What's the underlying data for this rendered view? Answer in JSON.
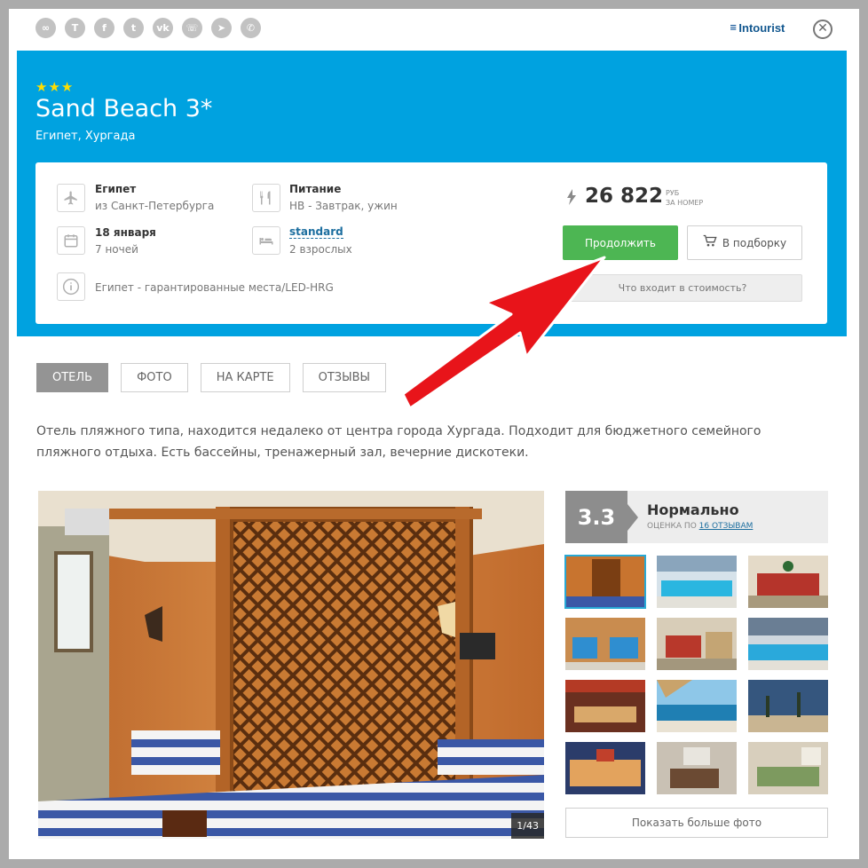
{
  "share": {
    "buttons": [
      {
        "icon": "link-icon",
        "glyph": "∞"
      },
      {
        "icon": "t-icon",
        "glyph": "T"
      },
      {
        "icon": "facebook-icon",
        "glyph": "f"
      },
      {
        "icon": "twitter-icon",
        "glyph": "t"
      },
      {
        "icon": "vk-icon",
        "glyph": "vk"
      },
      {
        "icon": "whatsapp-icon",
        "glyph": "☏"
      },
      {
        "icon": "telegram-icon",
        "glyph": "➤"
      },
      {
        "icon": "viber-icon",
        "glyph": "✆"
      }
    ]
  },
  "brand": {
    "name": "Intourist",
    "mark": "≡"
  },
  "close_glyph": "✕",
  "hotel": {
    "stars": "★★★",
    "name": "Sand Beach 3*",
    "location": "Египет, Хургада"
  },
  "tour": {
    "country_title": "Египет",
    "country_sub": "из Санкт-Петербурга",
    "meal_title": "Питание",
    "meal_sub": "HB - Завтрак, ужин",
    "date_title": "18 января",
    "date_sub": "7 ночей",
    "room_title": "standard",
    "room_sub": "2 взрослых",
    "note": "Египет - гарантированные места/LED-HRG"
  },
  "price": {
    "amount": "26 822",
    "currency": "РУБ",
    "per": "ЗА НОМЕР"
  },
  "actions": {
    "continue": "Продолжить",
    "add_to_collection": "В подборку",
    "whats_included": "Что входит в стоимость?"
  },
  "tabs": [
    {
      "label": "ОТЕЛЬ",
      "active": true
    },
    {
      "label": "ФОТО",
      "active": false
    },
    {
      "label": "НА КАРТЕ",
      "active": false
    },
    {
      "label": "ОТЗЫВЫ",
      "active": false
    }
  ],
  "description": "Отель пляжного типа, находится недалеко от центра города Хургада. Подходит для бюджетного семейного пляжного отдыха. Есть бассейны, тренажерный зал, вечерние дискотеки.",
  "gallery": {
    "counter": "1/43",
    "more_button": "Показать больше фото"
  },
  "rating": {
    "score": "3.3",
    "label": "Нормально",
    "sub_prefix": "ОЦЕНКА ПО",
    "reviews_link": "16 ОТЗЫВАМ"
  },
  "colors": {
    "header_blue": "#00a2e0",
    "continue_green": "#4db653",
    "star_yellow": "#ffde00",
    "annotation_red": "#e8141a"
  }
}
